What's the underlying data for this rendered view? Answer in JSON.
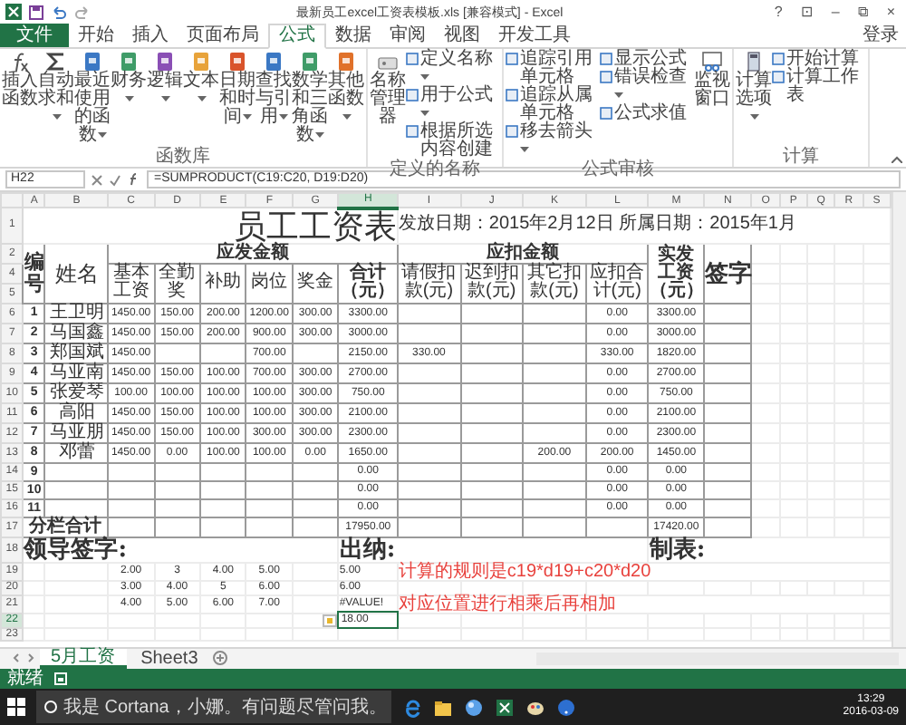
{
  "window": {
    "title": "最新员工excel工资表模板.xls [兼容模式] - Excel",
    "controls": [
      "?",
      "⊡",
      "–",
      "⧉",
      "×"
    ]
  },
  "ribbon_tabs": [
    {
      "label": "文件",
      "selected": false,
      "kind": "file"
    },
    {
      "label": "开始",
      "selected": false,
      "kind": "tab"
    },
    {
      "label": "插入",
      "selected": false,
      "kind": "tab"
    },
    {
      "label": "页面布局",
      "selected": false,
      "kind": "tab"
    },
    {
      "label": "公式",
      "selected": true,
      "kind": "tab"
    },
    {
      "label": "数据",
      "selected": false,
      "kind": "tab"
    },
    {
      "label": "审阅",
      "selected": false,
      "kind": "tab"
    },
    {
      "label": "视图",
      "selected": false,
      "kind": "tab"
    },
    {
      "label": "开发工具",
      "selected": false,
      "kind": "tab"
    }
  ],
  "account": "登录",
  "ribbon_groups": [
    {
      "label": "函数库",
      "items": [
        {
          "kind": "large",
          "label": "插入函数",
          "dropdown": false
        },
        {
          "kind": "large",
          "label": "自动求和",
          "dropdown": true
        },
        {
          "kind": "large",
          "label": "最近使用的函数",
          "dropdown": true
        },
        {
          "kind": "large",
          "label": "财务",
          "dropdown": true
        },
        {
          "kind": "large",
          "label": "逻辑",
          "dropdown": true
        },
        {
          "kind": "large",
          "label": "文本",
          "dropdown": true
        },
        {
          "kind": "large",
          "label": "日期和时间",
          "dropdown": true
        },
        {
          "kind": "large",
          "label": "查找与引用",
          "dropdown": true
        },
        {
          "kind": "large",
          "label": "数学和三角函数",
          "dropdown": true
        },
        {
          "kind": "large",
          "label": "其他函数",
          "dropdown": true
        }
      ]
    },
    {
      "label": "定义的名称",
      "items": [
        {
          "kind": "large",
          "label": "名称管理器",
          "dropdown": false
        },
        {
          "kind": "stack",
          "entries": [
            {
              "label": "定义名称",
              "dropdown": true
            },
            {
              "label": "用于公式",
              "dropdown": true
            },
            {
              "label": "根据所选内容创建",
              "dropdown": false
            }
          ]
        }
      ]
    },
    {
      "label": "公式审核",
      "items": [
        {
          "kind": "stack",
          "entries": [
            {
              "label": "追踪引用单元格",
              "dropdown": false
            },
            {
              "label": "追踪从属单元格",
              "dropdown": false
            },
            {
              "label": "移去箭头",
              "dropdown": true
            }
          ]
        },
        {
          "kind": "stack",
          "entries": [
            {
              "label": "显示公式",
              "dropdown": false
            },
            {
              "label": "错误检查",
              "dropdown": true
            },
            {
              "label": "公式求值",
              "dropdown": false
            }
          ]
        },
        {
          "kind": "large",
          "label": "监视窗口",
          "dropdown": false
        }
      ]
    },
    {
      "label": "计算",
      "items": [
        {
          "kind": "large",
          "label": "计算选项",
          "dropdown": true
        },
        {
          "kind": "stack",
          "entries": [
            {
              "label": "开始计算",
              "dropdown": false
            },
            {
              "label": "计算工作表",
              "dropdown": false
            }
          ]
        }
      ]
    }
  ],
  "formula_bar": {
    "name_box": "H22",
    "formula": "=SUMPRODUCT(C19:C20, D19:D20)"
  },
  "sheet": {
    "columns": [
      "A",
      "B",
      "C",
      "D",
      "E",
      "F",
      "G",
      "H",
      "I",
      "J",
      "K",
      "L",
      "M",
      "N",
      "O",
      "P",
      "Q",
      "R",
      "S"
    ],
    "title_row": {
      "row": "1",
      "title": "员工工资表",
      "subtitle": "发放日期：2015年2月12日 所属日期：2015年1月"
    },
    "header": {
      "rows": [
        "2",
        "4",
        "5"
      ],
      "id_label": "编号",
      "name_label": "姓名",
      "net_label": "实发工资（元）",
      "sign_label": "签字",
      "groups": [
        {
          "label": "应发金额",
          "columns": [
            "基本工资",
            "全勤奖",
            "补助",
            "岗位",
            "奖金",
            "合计（元）"
          ]
        },
        {
          "label": "应扣金额",
          "columns": [
            "请假扣款(元)",
            "迟到扣款(元)",
            "其它扣款(元)",
            "应扣合计(元)"
          ]
        }
      ]
    },
    "employees": [
      {
        "row": "6",
        "no": "1",
        "name": "王卫明",
        "cells": {
          "C": "1450.00",
          "D": "150.00",
          "E": "200.00",
          "F": "1200.00",
          "G": "300.00",
          "H": "3300.00",
          "L": "0.00",
          "M": "3300.00"
        }
      },
      {
        "row": "7",
        "no": "2",
        "name": "马国鑫",
        "cells": {
          "C": "1450.00",
          "D": "150.00",
          "E": "200.00",
          "F": "900.00",
          "G": "300.00",
          "H": "3000.00",
          "L": "0.00",
          "M": "3000.00"
        }
      },
      {
        "row": "8",
        "no": "3",
        "name": "郑国斌",
        "cells": {
          "C": "1450.00",
          "F": "700.00",
          "H": "2150.00",
          "I": "330.00",
          "L": "330.00",
          "M": "1820.00"
        }
      },
      {
        "row": "9",
        "no": "4",
        "name": "马亚南",
        "cells": {
          "C": "1450.00",
          "D": "150.00",
          "E": "100.00",
          "F": "700.00",
          "G": "300.00",
          "H": "2700.00",
          "L": "0.00",
          "M": "2700.00"
        }
      },
      {
        "row": "10",
        "no": "5",
        "name": "张爱琴",
        "cells": {
          "C": "100.00",
          "D": "100.00",
          "E": "100.00",
          "F": "100.00",
          "G": "300.00",
          "H": "750.00",
          "L": "0.00",
          "M": "750.00"
        }
      },
      {
        "row": "11",
        "no": "6",
        "name": "高阳",
        "cells": {
          "C": "1450.00",
          "D": "150.00",
          "E": "100.00",
          "F": "100.00",
          "G": "300.00",
          "H": "2100.00",
          "L": "0.00",
          "M": "2100.00"
        }
      },
      {
        "row": "12",
        "no": "7",
        "name": "马亚朋",
        "cells": {
          "C": "1450.00",
          "D": "150.00",
          "E": "100.00",
          "F": "300.00",
          "G": "300.00",
          "H": "2300.00",
          "L": "0.00",
          "M": "2300.00"
        }
      },
      {
        "row": "13",
        "no": "8",
        "name": "邓蕾",
        "cells": {
          "C": "1450.00",
          "D": "0.00",
          "E": "100.00",
          "F": "100.00",
          "G": "0.00",
          "H": "1650.00",
          "K": "200.00",
          "L": "200.00",
          "M": "1450.00"
        }
      },
      {
        "row": "14",
        "no": "9",
        "cells": {
          "H": "0.00",
          "L": "0.00",
          "M": "0.00"
        }
      },
      {
        "row": "15",
        "no": "10",
        "cells": {
          "H": "0.00",
          "L": "0.00",
          "M": "0.00"
        }
      },
      {
        "row": "16",
        "no": "11",
        "cells": {
          "H": "0.00",
          "L": "0.00",
          "M": "0.00"
        }
      }
    ],
    "total": {
      "row": "17",
      "label": "分栏合计",
      "gross": "17950.00",
      "net": "17420.00"
    },
    "signatures": {
      "row": "18",
      "items": [
        "领导签字:",
        "出纳:",
        "制表:"
      ]
    },
    "calc_rows": [
      {
        "row": "19",
        "cells": {
          "C": "2.00",
          "D": "3",
          "E": "4.00",
          "F": "5.00"
        },
        "result": "5.00",
        "note": "计算的规则是c19*d19+c20*d20",
        "selected": false
      },
      {
        "row": "20",
        "cells": {
          "C": "3.00",
          "D": "4.00",
          "E": "5",
          "F": "6.00"
        },
        "result": "6.00",
        "selected": false
      },
      {
        "row": "21",
        "cells": {
          "C": "4.00",
          "D": "5.00",
          "E": "6.00",
          "F": "7.00"
        },
        "result": "#VALUE!",
        "note": "对应位置进行相乘后再相加",
        "selected": false
      },
      {
        "row": "22",
        "result": "18.00",
        "selected": true,
        "paste_options": true
      }
    ],
    "empty_rows": [
      "23"
    ]
  },
  "sheet_tabs": [
    {
      "label": "5月工资",
      "selected": true
    },
    {
      "label": "Sheet3",
      "selected": false
    }
  ],
  "status": "就绪",
  "taskbar": {
    "search_placeholder": "我是 Cortana，小娜。有问题尽管问我。",
    "time": "13:29",
    "date": "2016-03-09"
  }
}
